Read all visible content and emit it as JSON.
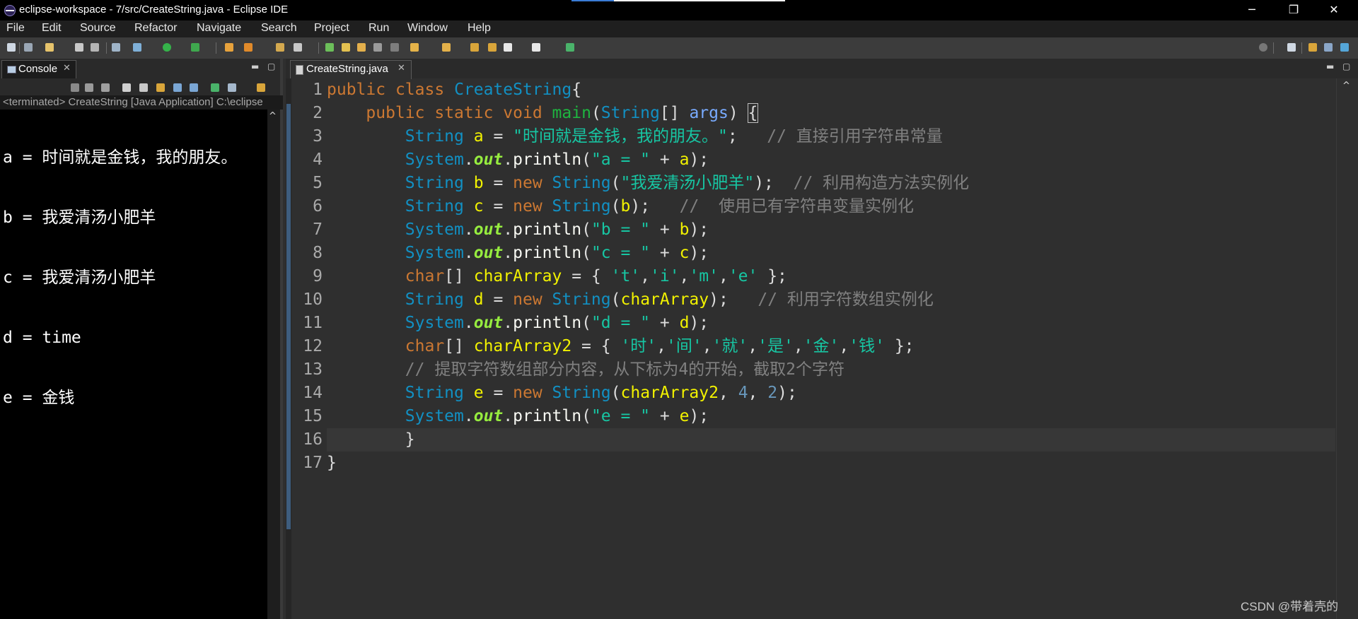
{
  "window": {
    "title": "eclipse-workspace - 7/src/CreateString.java - Eclipse IDE",
    "minimize": "─",
    "restore": "❐",
    "close": "✕"
  },
  "menu": [
    "File",
    "Edit",
    "Source",
    "Refactor",
    "Navigate",
    "Search",
    "Project",
    "Run",
    "Window",
    "Help"
  ],
  "console": {
    "tab_label": "Console",
    "close": "✕",
    "description": "<terminated> CreateString [Java Application] C:\\eclipse",
    "output": [
      "a = 时间就是金钱，我的朋友。",
      "b = 我爱清汤小肥羊",
      "c = 我爱清汤小肥羊",
      "d = time",
      "e = 金钱"
    ]
  },
  "editor": {
    "tab_label": "CreateString.java",
    "close": "✕",
    "line_numbers": [
      "1",
      "2",
      "3",
      "4",
      "5",
      "6",
      "7",
      "8",
      "9",
      "10",
      "11",
      "12",
      "13",
      "14",
      "15",
      "16",
      "17"
    ],
    "current_line": 16
  },
  "watermark": "CSDN @带着壳的",
  "colors": {
    "keyword": "#cc7832",
    "type": "#1290c3",
    "method": "#1eb540",
    "string": "#17c6a3",
    "comment": "#808080",
    "static_field": "#96ec3f",
    "local_var": "#f2f200",
    "param": "#79abff",
    "number": "#6897bb"
  }
}
